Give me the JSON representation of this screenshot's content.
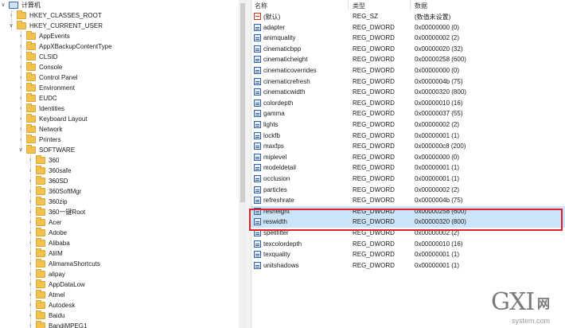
{
  "tree": {
    "root": "计算机",
    "nodes": [
      {
        "label": "HKEY_CLASSES_ROOT",
        "expanded": false
      },
      {
        "label": "HKEY_CURRENT_USER",
        "expanded": true
      },
      {
        "label": "AppEvents",
        "expanded": false
      },
      {
        "label": "AppXBackupContentType",
        "expanded": false
      },
      {
        "label": "CLSID",
        "expanded": false
      },
      {
        "label": "Console",
        "expanded": false
      },
      {
        "label": "Control Panel",
        "expanded": false
      },
      {
        "label": "Environment",
        "expanded": false
      },
      {
        "label": "EUDC",
        "expanded": false
      },
      {
        "label": "Identities",
        "expanded": false
      },
      {
        "label": "Keyboard Layout",
        "expanded": false
      },
      {
        "label": "Network",
        "expanded": false
      },
      {
        "label": "Printers",
        "expanded": false
      },
      {
        "label": "SOFTWARE",
        "expanded": true
      },
      {
        "label": "360",
        "expanded": false
      },
      {
        "label": "360safe",
        "expanded": false
      },
      {
        "label": "360SD",
        "expanded": false
      },
      {
        "label": "360SoftMgr",
        "expanded": false
      },
      {
        "label": "360zip",
        "expanded": false
      },
      {
        "label": "360一键Root",
        "expanded": false
      },
      {
        "label": "Acer",
        "expanded": false
      },
      {
        "label": "Adobe",
        "expanded": false
      },
      {
        "label": "Alibaba",
        "expanded": false
      },
      {
        "label": "AliIM",
        "expanded": false
      },
      {
        "label": "AlimamaShortcuts",
        "expanded": false
      },
      {
        "label": "alipay",
        "expanded": false
      },
      {
        "label": "AppDataLow",
        "expanded": false
      },
      {
        "label": "Atmel",
        "expanded": false
      },
      {
        "label": "Autodesk",
        "expanded": false
      },
      {
        "label": "Baidu",
        "expanded": false
      },
      {
        "label": "BandiMPEG1",
        "expanded": false
      }
    ]
  },
  "columns": {
    "name": "名称",
    "type": "类型",
    "data": "数据"
  },
  "values": [
    {
      "name": "(默认)",
      "type": "REG_SZ",
      "data": "(数值未设置)",
      "icon": "string-value-icon"
    },
    {
      "name": "adapter",
      "type": "REG_DWORD",
      "data": "0x00000000 (0)",
      "icon": "dword-value-icon"
    },
    {
      "name": "animquality",
      "type": "REG_DWORD",
      "data": "0x00000002 (2)",
      "icon": "dword-value-icon"
    },
    {
      "name": "cinematicbpp",
      "type": "REG_DWORD",
      "data": "0x00000020 (32)",
      "icon": "dword-value-icon"
    },
    {
      "name": "cinematicheight",
      "type": "REG_DWORD",
      "data": "0x00000258 (600)",
      "icon": "dword-value-icon"
    },
    {
      "name": "cinematicoverrides",
      "type": "REG_DWORD",
      "data": "0x00000000 (0)",
      "icon": "dword-value-icon"
    },
    {
      "name": "cinematicrefresh",
      "type": "REG_DWORD",
      "data": "0x0000004b (75)",
      "icon": "dword-value-icon"
    },
    {
      "name": "cinematicwidth",
      "type": "REG_DWORD",
      "data": "0x00000320 (800)",
      "icon": "dword-value-icon"
    },
    {
      "name": "colordepth",
      "type": "REG_DWORD",
      "data": "0x00000010 (16)",
      "icon": "dword-value-icon"
    },
    {
      "name": "gamma",
      "type": "REG_DWORD",
      "data": "0x00000037 (55)",
      "icon": "dword-value-icon"
    },
    {
      "name": "lights",
      "type": "REG_DWORD",
      "data": "0x00000002 (2)",
      "icon": "dword-value-icon"
    },
    {
      "name": "lockfb",
      "type": "REG_DWORD",
      "data": "0x00000001 (1)",
      "icon": "dword-value-icon"
    },
    {
      "name": "maxfps",
      "type": "REG_DWORD",
      "data": "0x000000c8 (200)",
      "icon": "dword-value-icon"
    },
    {
      "name": "miplevel",
      "type": "REG_DWORD",
      "data": "0x00000000 (0)",
      "icon": "dword-value-icon"
    },
    {
      "name": "modeldetail",
      "type": "REG_DWORD",
      "data": "0x00000001 (1)",
      "icon": "dword-value-icon"
    },
    {
      "name": "occlusion",
      "type": "REG_DWORD",
      "data": "0x00000001 (1)",
      "icon": "dword-value-icon"
    },
    {
      "name": "particles",
      "type": "REG_DWORD",
      "data": "0x00000002 (2)",
      "icon": "dword-value-icon"
    },
    {
      "name": "refreshrate",
      "type": "REG_DWORD",
      "data": "0x0000004b (75)",
      "icon": "dword-value-icon"
    },
    {
      "name": "resheight",
      "type": "REG_DWORD",
      "data": "0x00000258 (600)",
      "icon": "dword-value-icon",
      "selected": true
    },
    {
      "name": "reswidth",
      "type": "REG_DWORD",
      "data": "0x00000320 (800)",
      "icon": "dword-value-icon",
      "selected": true
    },
    {
      "name": "spellfilter",
      "type": "REG_DWORD",
      "data": "0x00000002 (2)",
      "icon": "dword-value-icon"
    },
    {
      "name": "texcolordepth",
      "type": "REG_DWORD",
      "data": "0x00000010 (16)",
      "icon": "dword-value-icon"
    },
    {
      "name": "texquality",
      "type": "REG_DWORD",
      "data": "0x00000001 (1)",
      "icon": "dword-value-icon"
    },
    {
      "name": "unitshadows",
      "type": "REG_DWORD",
      "data": "0x00000001 (1)",
      "icon": "dword-value-icon"
    }
  ],
  "watermark": {
    "brand": "GXI",
    "cn": "网",
    "domain": "system.com"
  },
  "colors": {
    "selection": "#cce4f7",
    "highlight_border": "#e0202a",
    "folder": "#f2c14e"
  }
}
